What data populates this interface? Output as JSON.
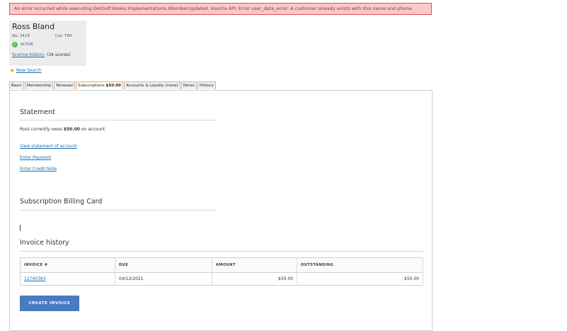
{
  "error": {
    "message": "An error occurred while executing DotGolf.Hooks.Implementations.IMemberUpdated. Kounta API: Error user_data_error: A customer already exists with this name and phone."
  },
  "member": {
    "name": "Ross Bland",
    "number": "No. 3418",
    "category": "Cat: TWI",
    "status": "ACTIVE",
    "scoring_history_label": "Scoring History",
    "scoring_count": "(34 scores)"
  },
  "nav": {
    "new_search": "New Search"
  },
  "tabs": [
    {
      "label": "Basic"
    },
    {
      "label": "Membership"
    },
    {
      "label": "Renewal"
    },
    {
      "label": "Subscriptions",
      "badge": "$50.00"
    },
    {
      "label": "Accounts & Loyalty (none)"
    },
    {
      "label": "Notes"
    },
    {
      "label": "History"
    }
  ],
  "statement": {
    "title": "Statement",
    "owes_prefix": "Ross currently owes",
    "owes_amount": "$50.00",
    "owes_suffix": "on account.",
    "links": {
      "view": "View statement of account",
      "payment": "Enter Payment",
      "credit": "Enter Credit Note"
    }
  },
  "billing_card": {
    "title": "Subscription Billing Card"
  },
  "invoice_history": {
    "title": "Invoice history",
    "columns": [
      "INVOICE #",
      "DUE",
      "AMOUNT",
      "OUTSTANDING"
    ],
    "rows": [
      {
        "invoice": "12740363",
        "due": "04/12/2021",
        "amount": "$50.00",
        "outstanding": "$50.00"
      }
    ],
    "create_button": "CREATE INVOICE"
  },
  "colors": {
    "accent": "#4a7ac2",
    "link": "#1a6fb0",
    "error_bg": "#f7c9c9",
    "error_border": "#d9534f",
    "active_status": "#5cb85c",
    "active_tab_border": "#e8a850"
  }
}
